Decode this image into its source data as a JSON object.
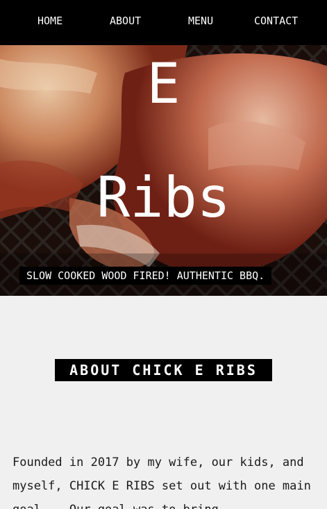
{
  "nav": {
    "items": [
      {
        "label": "HOME"
      },
      {
        "label": "ABOUT"
      },
      {
        "label": "MENU"
      },
      {
        "label": "CONTACT"
      }
    ]
  },
  "hero": {
    "title_line1": "E",
    "title_line2": "Ribs",
    "tagline": "SLOW COOKED WOOD FIRED! AUTHENTIC BBQ."
  },
  "about": {
    "heading": "ABOUT CHICK E RIBS",
    "body": "Founded in 2017 by my wife, our kids, and myself, CHICK E RIBS set out with one main goal... Our goal was to bring"
  },
  "colors": {
    "nav_bg": "#000000",
    "page_bg": "#f0f0f0",
    "accent_text": "#ffffff"
  }
}
